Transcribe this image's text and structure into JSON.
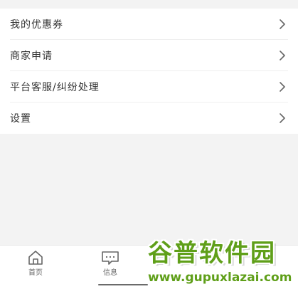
{
  "menu": {
    "items": [
      {
        "label": "我的优惠券"
      },
      {
        "label": "商家申请"
      },
      {
        "label": "平台客服/纠纷处理"
      },
      {
        "label": "设置"
      }
    ]
  },
  "bottom_nav": {
    "items": [
      {
        "label": "首页",
        "icon": "home-icon"
      },
      {
        "label": "信息",
        "icon": "message-icon"
      }
    ]
  },
  "watermark": {
    "top": "谷普软件园",
    "bottom": "www.gupuxlazai.com"
  },
  "colors": {
    "background": "#f3f3f3",
    "card": "#ffffff",
    "text": "#333333",
    "watermark": "#5f9f19"
  }
}
